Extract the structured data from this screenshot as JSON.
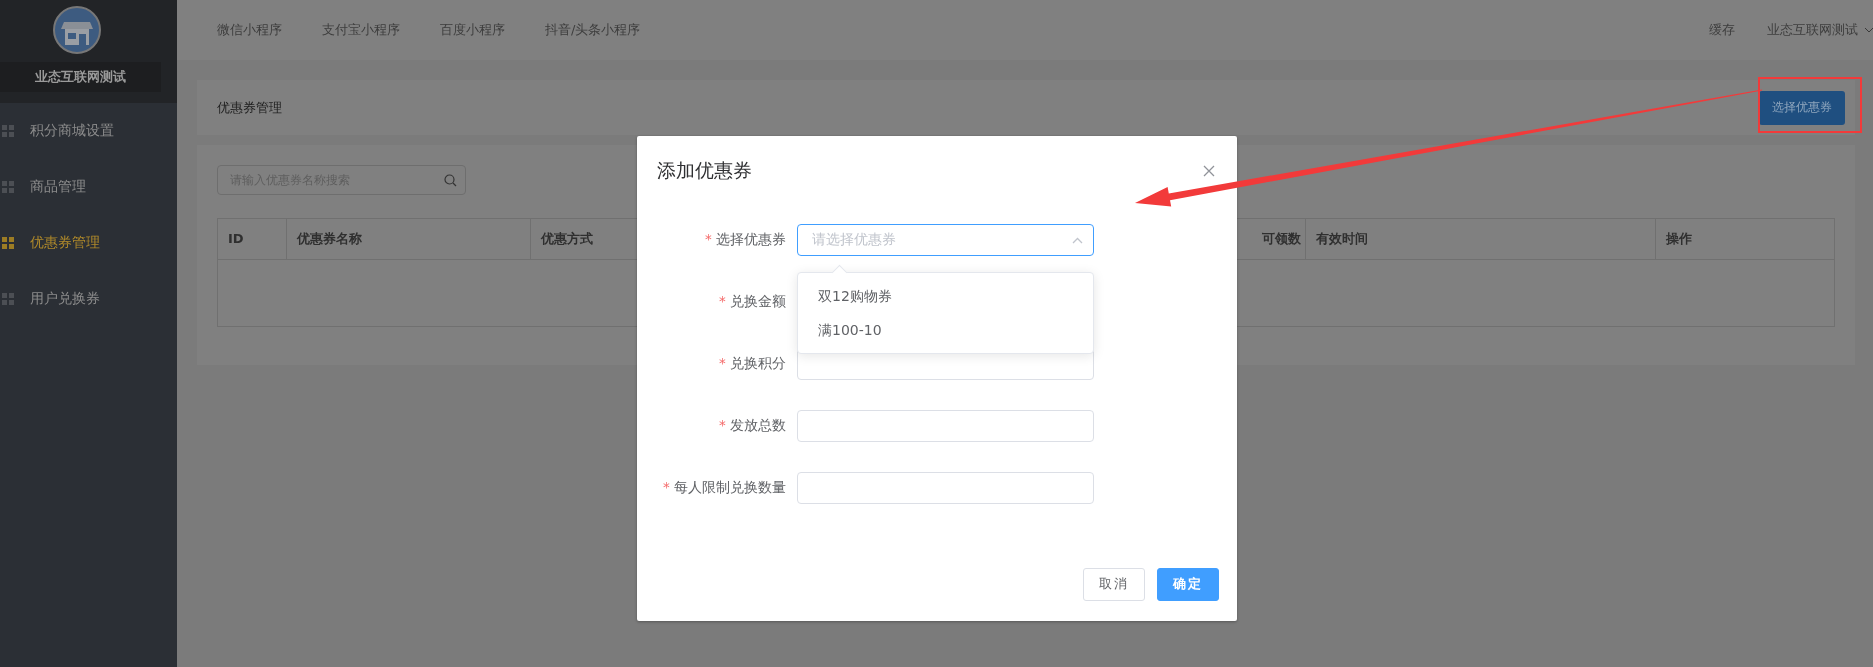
{
  "sidebar": {
    "brand": "业态互联网测试",
    "items": [
      {
        "label": "积分商城设置",
        "selected": false
      },
      {
        "label": "商品管理",
        "selected": false
      },
      {
        "label": "优惠券管理",
        "selected": true
      },
      {
        "label": "用户兑换券",
        "selected": false
      }
    ]
  },
  "top_nav": {
    "links": [
      "微信小程序",
      "支付宝小程序",
      "百度小程序",
      "抖音/头条小程序"
    ],
    "cache": "缓存",
    "user": "业态互联网测试"
  },
  "page_header": {
    "title": "优惠券管理",
    "button": "选择优惠券"
  },
  "search": {
    "placeholder": "请输入优惠券名称搜索"
  },
  "table": {
    "columns": [
      "ID",
      "优惠券名称",
      "优惠方式",
      "可领数",
      "有效时间",
      "操作"
    ]
  },
  "dialog": {
    "title": "添加优惠券",
    "fields": [
      {
        "label": "选择优惠券",
        "required_mark": "*",
        "kind": "select",
        "placeholder": "请选择优惠券",
        "expanded": true
      },
      {
        "label": "兑换金额",
        "required_mark": "*",
        "kind": "covered"
      },
      {
        "label": "兑换积分",
        "required_mark": "*",
        "kind": "input"
      },
      {
        "label": "发放总数",
        "required_mark": "*",
        "kind": "input"
      },
      {
        "label": "每人限制兑换数量",
        "required_mark": "*",
        "kind": "input"
      }
    ],
    "options": [
      "双12购物券",
      "满100-10"
    ],
    "buttons": [
      {
        "label": "取消",
        "kind": "default"
      },
      {
        "label": "确定",
        "kind": "primary"
      }
    ]
  }
}
